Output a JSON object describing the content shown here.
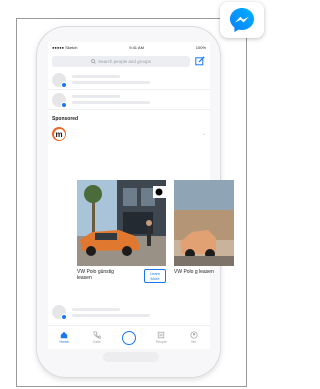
{
  "status_bar": {
    "carrier": "●●●●● Sketch",
    "time": "9:41 AM",
    "battery": "100%"
  },
  "search": {
    "placeholder": "Search people and groups"
  },
  "feed": {
    "sponsored_label": "Sponsored"
  },
  "ad": {
    "brand_initial": "m",
    "brand_color": "#f16522",
    "cards": [
      {
        "title": "VW Polo günstig leasen",
        "cta": "Learn More"
      },
      {
        "title": "VW Polo g leasen"
      }
    ]
  },
  "nav": {
    "items": [
      {
        "label": "Home",
        "icon": "home-icon"
      },
      {
        "label": "Calls",
        "icon": "phone-icon"
      },
      {
        "label": "",
        "icon": "camera-circle-icon"
      },
      {
        "label": "People",
        "icon": "people-icon"
      },
      {
        "label": "Me",
        "icon": "profile-icon"
      }
    ]
  },
  "colors": {
    "accent": "#1a77f2"
  }
}
